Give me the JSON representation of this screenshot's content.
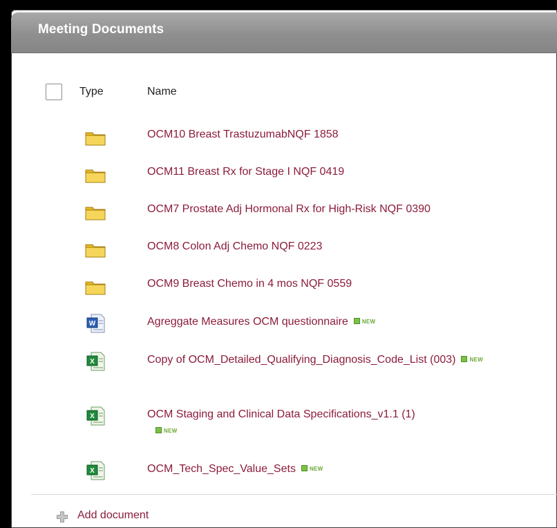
{
  "panel": {
    "title": "Meeting Documents"
  },
  "columns": {
    "type": "Type",
    "name": "Name"
  },
  "documents": [
    {
      "icon": "folder-icon",
      "name": "OCM10 Breast TrastuzumabNQF 1858",
      "is_new": false
    },
    {
      "icon": "folder-icon",
      "name": "OCM11 Breast Rx for Stage I NQF 0419",
      "is_new": false
    },
    {
      "icon": "folder-icon",
      "name": "OCM7 Prostate Adj Hormonal Rx for High-Risk NQF 0390",
      "is_new": false
    },
    {
      "icon": "folder-icon",
      "name": "OCM8 Colon Adj Chemo NQF 0223",
      "is_new": false
    },
    {
      "icon": "folder-icon",
      "name": "OCM9 Breast Chemo in 4 mos NQF 0559",
      "is_new": false
    },
    {
      "icon": "word-doc-icon",
      "name": "Agreggate Measures OCM questionnaire",
      "is_new": true
    },
    {
      "icon": "excel-doc-icon",
      "name": "Copy of OCM_Detailed_Qualifying_Diagnosis_Code_List (003)",
      "is_new": true
    },
    {
      "icon": "excel-doc-icon",
      "name": "OCM Staging and Clinical Data Specifications_v1.1 (1)",
      "is_new": true
    },
    {
      "icon": "excel-doc-icon",
      "name": "OCM_Tech_Spec_Value_Sets",
      "is_new": true
    }
  ],
  "badge": {
    "new_label": "NEW",
    "color": "#7cc242"
  },
  "footer": {
    "add_label": "Add document",
    "add_icon": "add-icon"
  },
  "colors": {
    "link": "#8b1c3a",
    "header_bg": "#8f8f8f",
    "page_bg": "#000000"
  }
}
